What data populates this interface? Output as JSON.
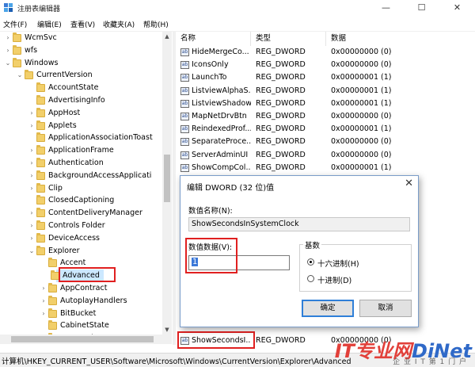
{
  "window": {
    "title": "注册表编辑器",
    "min_glyph": "—",
    "max_glyph": "☐",
    "close_glyph": "✕"
  },
  "menu": [
    "文件(F)",
    "编辑(E)",
    "查看(V)",
    "收藏夹(A)",
    "帮助(H)"
  ],
  "tree": {
    "items": [
      {
        "label": "WcmSvc",
        "level": 1,
        "expander": "collapsed"
      },
      {
        "label": "wfs",
        "level": 1,
        "expander": "collapsed"
      },
      {
        "label": "Windows",
        "level": 1,
        "expander": "expanded"
      },
      {
        "label": "CurrentVersion",
        "level": 2,
        "expander": "expanded"
      },
      {
        "label": "AccountState",
        "level": 3,
        "expander": "none"
      },
      {
        "label": "AdvertisingInfo",
        "level": 3,
        "expander": "none"
      },
      {
        "label": "AppHost",
        "level": 3,
        "expander": "collapsed"
      },
      {
        "label": "Applets",
        "level": 3,
        "expander": "collapsed"
      },
      {
        "label": "ApplicationAssociationToast",
        "level": 3,
        "expander": "none"
      },
      {
        "label": "ApplicationFrame",
        "level": 3,
        "expander": "collapsed"
      },
      {
        "label": "Authentication",
        "level": 3,
        "expander": "collapsed"
      },
      {
        "label": "BackgroundAccessApplicati",
        "level": 3,
        "expander": "collapsed"
      },
      {
        "label": "Clip",
        "level": 3,
        "expander": "collapsed"
      },
      {
        "label": "ClosedCaptioning",
        "level": 3,
        "expander": "none"
      },
      {
        "label": "ContentDeliveryManager",
        "level": 3,
        "expander": "collapsed"
      },
      {
        "label": "Controls Folder",
        "level": 3,
        "expander": "collapsed"
      },
      {
        "label": "DeviceAccess",
        "level": 3,
        "expander": "collapsed"
      },
      {
        "label": "Explorer",
        "level": 3,
        "expander": "expanded"
      },
      {
        "label": "Accent",
        "level": 4,
        "expander": "none"
      },
      {
        "label": "Advanced",
        "level": 4,
        "expander": "none",
        "selected": true
      },
      {
        "label": "AppContract",
        "level": 4,
        "expander": "collapsed"
      },
      {
        "label": "AutoplayHandlers",
        "level": 4,
        "expander": "collapsed"
      },
      {
        "label": "BitBucket",
        "level": 4,
        "expander": "collapsed"
      },
      {
        "label": "CabinetState",
        "level": 4,
        "expander": "none"
      },
      {
        "label": "CD Burning",
        "level": 4,
        "expander": "collapsed"
      }
    ]
  },
  "values": {
    "columns": [
      "名称",
      "类型",
      "数据"
    ],
    "rows": [
      {
        "name": "HideMergeCo...",
        "type": "REG_DWORD",
        "data": "0x00000000 (0)"
      },
      {
        "name": "IconsOnly",
        "type": "REG_DWORD",
        "data": "0x00000000 (0)"
      },
      {
        "name": "LaunchTo",
        "type": "REG_DWORD",
        "data": "0x00000001 (1)"
      },
      {
        "name": "ListviewAlphaS...",
        "type": "REG_DWORD",
        "data": "0x00000001 (1)"
      },
      {
        "name": "ListviewShadow",
        "type": "REG_DWORD",
        "data": "0x00000001 (1)"
      },
      {
        "name": "MapNetDrvBtn",
        "type": "REG_DWORD",
        "data": "0x00000000 (0)"
      },
      {
        "name": "ReindexedProf...",
        "type": "REG_DWORD",
        "data": "0x00000001 (1)"
      },
      {
        "name": "SeparateProce...",
        "type": "REG_DWORD",
        "data": "0x00000000 (0)"
      },
      {
        "name": "ServerAdminUI",
        "type": "REG_DWORD",
        "data": "0x00000000 (0)"
      },
      {
        "name": "ShowCompCol...",
        "type": "REG_DWORD",
        "data": "0x00000001 (1)"
      }
    ],
    "last_row": {
      "name": "ShowSecondsI...",
      "type": "REG_DWORD",
      "data": "0x00000000 (0)"
    },
    "icon_text": "ab"
  },
  "dialog": {
    "title": "编辑 DWORD (32 位)值",
    "close_glyph": "✕",
    "name_label": "数值名称(N):",
    "name_value": "ShowSecondsInSystemClock",
    "data_label": "数值数据(V):",
    "data_value": "1",
    "base_label": "基数",
    "radio_hex": "十六进制(H)",
    "radio_dec": "十进制(D)",
    "ok": "确定",
    "cancel": "取消"
  },
  "status": {
    "path": "计算机\\HKEY_CURRENT_USER\\Software\\Microsoft\\Windows\\CurrentVersion\\Explorer\\Advanced"
  },
  "watermark": {
    "part1": "IT专业网",
    "part2": "DiNet",
    "sub": "企 业 I T 第 1 门 户"
  },
  "colors": {
    "highlight": "#e02020",
    "selection": "#cce8ff",
    "folder": "#f2cf6a"
  }
}
